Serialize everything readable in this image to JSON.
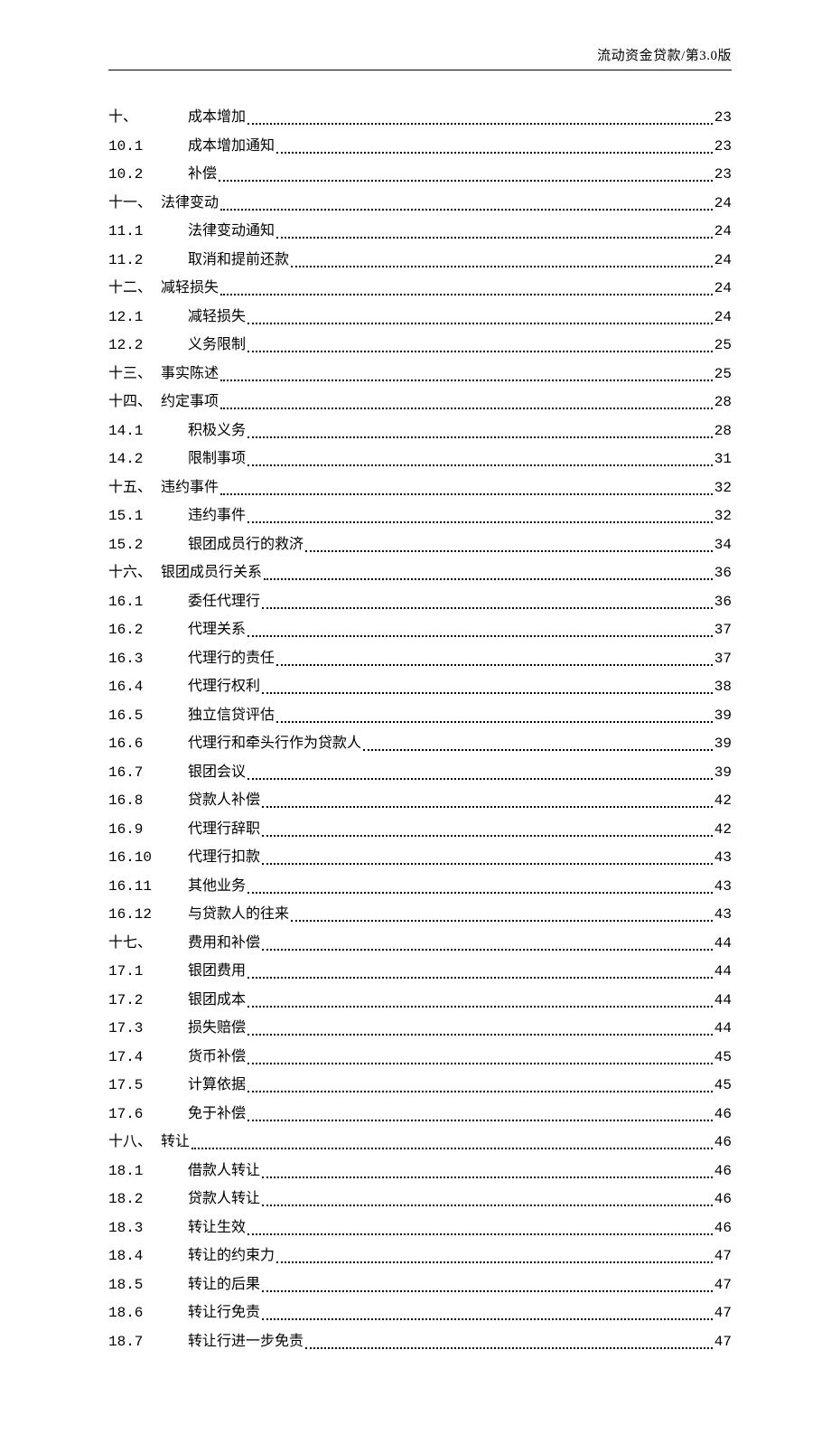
{
  "header": "流动资金贷款/第3.0版",
  "toc": [
    {
      "num": "十、",
      "title": "成本增加",
      "page": "23",
      "indent": true
    },
    {
      "num": "10.1",
      "title": "成本增加通知",
      "page": "23",
      "indent": true
    },
    {
      "num": "10.2",
      "title": "补偿",
      "page": "23",
      "indent": true
    },
    {
      "num": "十一、",
      "title": "法律变动",
      "page": "24",
      "indent": false
    },
    {
      "num": "11.1",
      "title": "法律变动通知",
      "page": "24",
      "indent": true
    },
    {
      "num": "11.2",
      "title": "取消和提前还款",
      "page": "24",
      "indent": true
    },
    {
      "num": "十二、",
      "title": "减轻损失",
      "page": "24",
      "indent": false
    },
    {
      "num": "12.1",
      "title": "减轻损失",
      "page": "24",
      "indent": true
    },
    {
      "num": "12.2",
      "title": "义务限制",
      "page": "25",
      "indent": true
    },
    {
      "num": "十三、",
      "title": "事实陈述",
      "page": "25",
      "indent": false
    },
    {
      "num": "十四、",
      "title": "约定事项",
      "page": "28",
      "indent": false
    },
    {
      "num": "14.1",
      "title": "积极义务",
      "page": "28",
      "indent": true
    },
    {
      "num": "14.2",
      "title": "限制事项",
      "page": "31",
      "indent": true
    },
    {
      "num": "十五、",
      "title": "违约事件",
      "page": "32",
      "indent": false
    },
    {
      "num": "15.1",
      "title": "违约事件",
      "page": "32",
      "indent": true
    },
    {
      "num": "15.2",
      "title": "银团成员行的救济",
      "page": "34",
      "indent": true
    },
    {
      "num": "十六、",
      "title": "银团成员行关系",
      "page": "36",
      "indent": false
    },
    {
      "num": "16.1",
      "title": "委任代理行",
      "page": "36",
      "indent": true
    },
    {
      "num": "16.2",
      "title": "代理关系",
      "page": "37",
      "indent": true
    },
    {
      "num": "16.3",
      "title": "代理行的责任",
      "page": "37",
      "indent": true
    },
    {
      "num": "16.4",
      "title": "代理行权利",
      "page": "38",
      "indent": true
    },
    {
      "num": "16.5",
      "title": "独立信贷评估",
      "page": "39",
      "indent": true
    },
    {
      "num": "16.6",
      "title": "代理行和牵头行作为贷款人",
      "page": "39",
      "indent": true
    },
    {
      "num": "16.7",
      "title": "银团会议",
      "page": "39",
      "indent": true
    },
    {
      "num": "16.8",
      "title": "贷款人补偿",
      "page": "42",
      "indent": true
    },
    {
      "num": "16.9",
      "title": "代理行辞职",
      "page": "42",
      "indent": true
    },
    {
      "num": "16.10",
      "title": "代理行扣款",
      "page": "43",
      "indent": true
    },
    {
      "num": "16.11",
      "title": "其他业务",
      "page": "43",
      "indent": true
    },
    {
      "num": "16.12",
      "title": "与贷款人的往来",
      "page": "43",
      "indent": true
    },
    {
      "num": "十七、",
      "title": "费用和补偿",
      "page": "44",
      "indent": true
    },
    {
      "num": "17.1",
      "title": "银团费用",
      "page": "44",
      "indent": true
    },
    {
      "num": "17.2",
      "title": "银团成本",
      "page": "44",
      "indent": true
    },
    {
      "num": "17.3",
      "title": "损失赔偿",
      "page": "44",
      "indent": true
    },
    {
      "num": "17.4",
      "title": "货币补偿",
      "page": "45",
      "indent": true
    },
    {
      "num": "17.5",
      "title": "计算依据",
      "page": "45",
      "indent": true
    },
    {
      "num": "17.6",
      "title": "免于补偿",
      "page": "46",
      "indent": true
    },
    {
      "num": "十八、",
      "title": "转让",
      "page": "46",
      "indent": false
    },
    {
      "num": "18.1",
      "title": "借款人转让",
      "page": "46",
      "indent": true
    },
    {
      "num": "18.2",
      "title": "贷款人转让",
      "page": "46",
      "indent": true
    },
    {
      "num": "18.3",
      "title": "转让生效",
      "page": "46",
      "indent": true
    },
    {
      "num": "18.4",
      "title": "转让的约束力",
      "page": "47",
      "indent": true
    },
    {
      "num": "18.5",
      "title": "转让的后果",
      "page": "47",
      "indent": true
    },
    {
      "num": "18.6",
      "title": "转让行免责",
      "page": "47",
      "indent": true
    },
    {
      "num": "18.7",
      "title": "转让行进一步免责",
      "page": "47",
      "indent": true
    }
  ]
}
